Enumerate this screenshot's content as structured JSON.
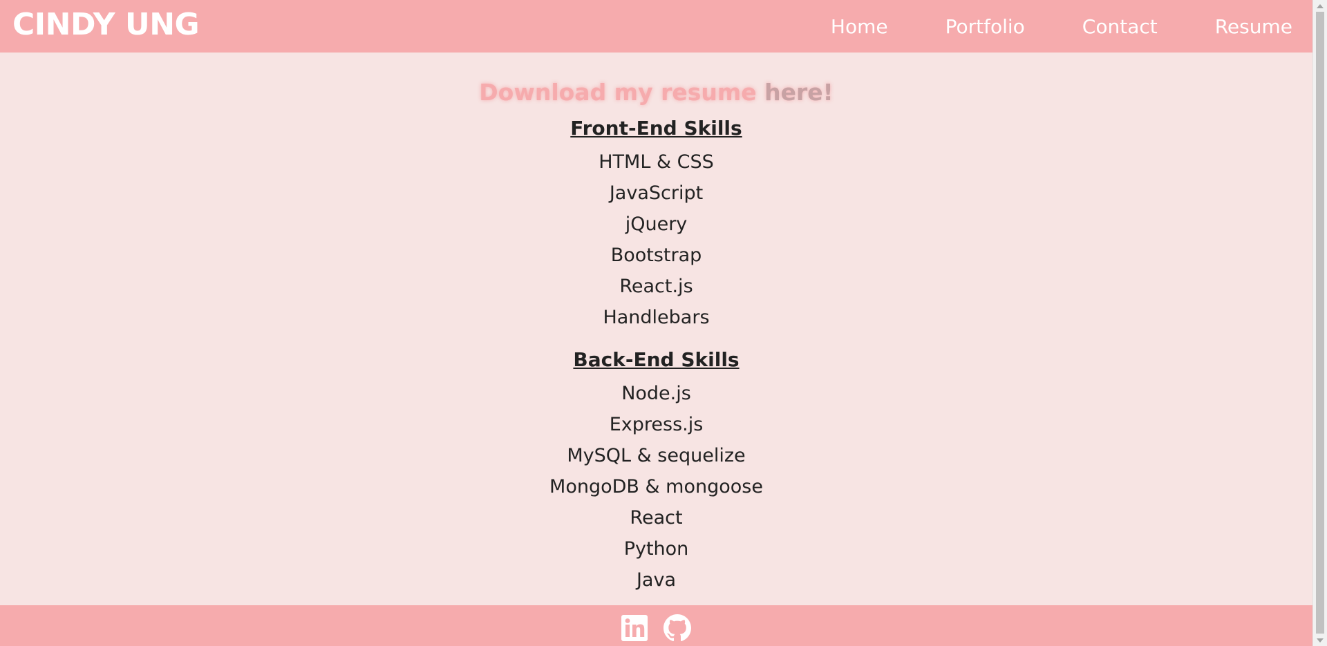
{
  "header": {
    "brand": "CINDY UNG",
    "nav": [
      {
        "label": "Home"
      },
      {
        "label": "Portfolio"
      },
      {
        "label": "Contact"
      },
      {
        "label": "Resume"
      }
    ]
  },
  "main": {
    "download": {
      "prefix": "Download my resume ",
      "link_label": "here!"
    },
    "front_end": {
      "title": "Front-End Skills",
      "items": [
        "HTML & CSS",
        "JavaScript",
        "jQuery",
        "Bootstrap",
        "React.js",
        "Handlebars"
      ]
    },
    "back_end": {
      "title": "Back-End Skills",
      "items": [
        "Node.js",
        "Express.js",
        "MySQL & sequelize",
        "MongoDB & mongoose",
        "React",
        "Python",
        "Java"
      ]
    }
  },
  "footer": {
    "icons": [
      "linkedin-icon",
      "github-icon"
    ]
  },
  "colors": {
    "header_bg": "#f6abad",
    "page_bg": "#f7e4e3",
    "text": "#222222",
    "link_muted": "#c8a2a4"
  }
}
